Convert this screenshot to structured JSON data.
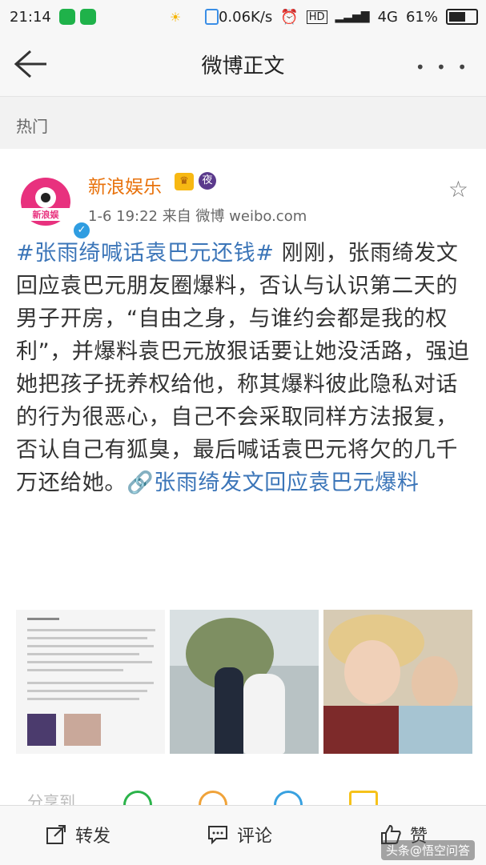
{
  "status_bar": {
    "time": "21:14",
    "speed": "0.06K/s",
    "hd": "HD",
    "network": "4G",
    "battery": "61%"
  },
  "navbar": {
    "title": "微博正文",
    "more": "• • •"
  },
  "section": {
    "label": "热门"
  },
  "post": {
    "username": "新浪娱乐",
    "avatar_caption": "新浪娱",
    "badge_night": "夜",
    "meta": "1-6 19:22  来自 微博 weibo.com",
    "hashtag": "#张雨绮喊话袁巴元还钱#",
    "body": " 刚刚，张雨绮发文回应袁巴元朋友圈爆料，否认与认识第二天的男子开房，“自由之身，与谁约会都是我的权利”，并爆料袁巴元放狠话要让她没活路，强迫她把孩子抚养权给他，称其爆料彼此隐私对话的行为很恶心，自己不会采取同样方法报复，否认自己有狐臭，最后喊话袁巴元将欠的几千万还给她。",
    "link_text": "张雨绮发文回应袁巴元爆料",
    "forward_label": "分享到"
  },
  "toolbar": {
    "forward": "转发",
    "comment": "评论",
    "like": "赞"
  },
  "watermark": "头条@悟空问答"
}
